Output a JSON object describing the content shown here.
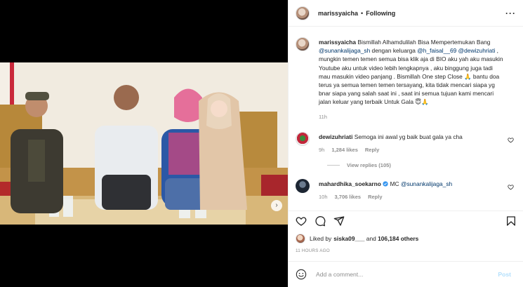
{
  "post": {
    "username": "marissyaicha",
    "follow_status": "Following",
    "caption_parts": {
      "t1": "Bismillah Alhamdulilah Bisa Mempertemukan Bang ",
      "m1": "@sunankalijaga_sh",
      "t2": " dengan keluarga ",
      "m2": "@h_faisal__69",
      "t3": " ",
      "m3": "@dewizuhriati",
      "t4": " , mungkin temen temen semua bisa klik aja di BIO aku yah aku masukin Youtube aku untuk video lebih lengkapnya , aku binggung juga tadi mau masukin video panjang . Bismillah One step Close 🙏 bantu doa terus ya semua temen temen tersayang, kita tidak mencari siapa yg bnar siapa yang salah saat ini , saat ini semua tujuan kami mencari jalan keluar yang terbaik Untuk Gala 😇🙏"
    },
    "caption_time": "11h"
  },
  "comments": [
    {
      "username": "dewizuhriati",
      "text": "Semoga ini awal yg baik buat gala ya cha",
      "time": "9h",
      "likes": "1,284 likes",
      "reply": "Reply",
      "view_replies": "View replies (105)"
    },
    {
      "username": "mahardhika_soekarno",
      "prefix": " MC ",
      "mention": "@sunankalijaga_sh",
      "time": "10h",
      "likes": "3,706 likes",
      "reply": "Reply"
    }
  ],
  "likes": {
    "prefix": "Liked by ",
    "user": "siska09___",
    "middle": " and ",
    "count": "106,184 others"
  },
  "time_ago": "11 HOURS AGO",
  "add_comment": {
    "placeholder": "Add a comment...",
    "post_label": "Post"
  },
  "icons": {
    "more": "more-options-icon",
    "like": "heart-icon",
    "comment": "comment-icon",
    "share": "share-icon",
    "save": "bookmark-icon",
    "emoji": "emoji-icon",
    "verified": "verified-badge-icon",
    "next": "chevron-right-icon"
  },
  "colors": {
    "mention": "#00376b",
    "muted": "#8e8e8e",
    "post_disabled": "#b2dffc",
    "verified": "#3897f0"
  }
}
